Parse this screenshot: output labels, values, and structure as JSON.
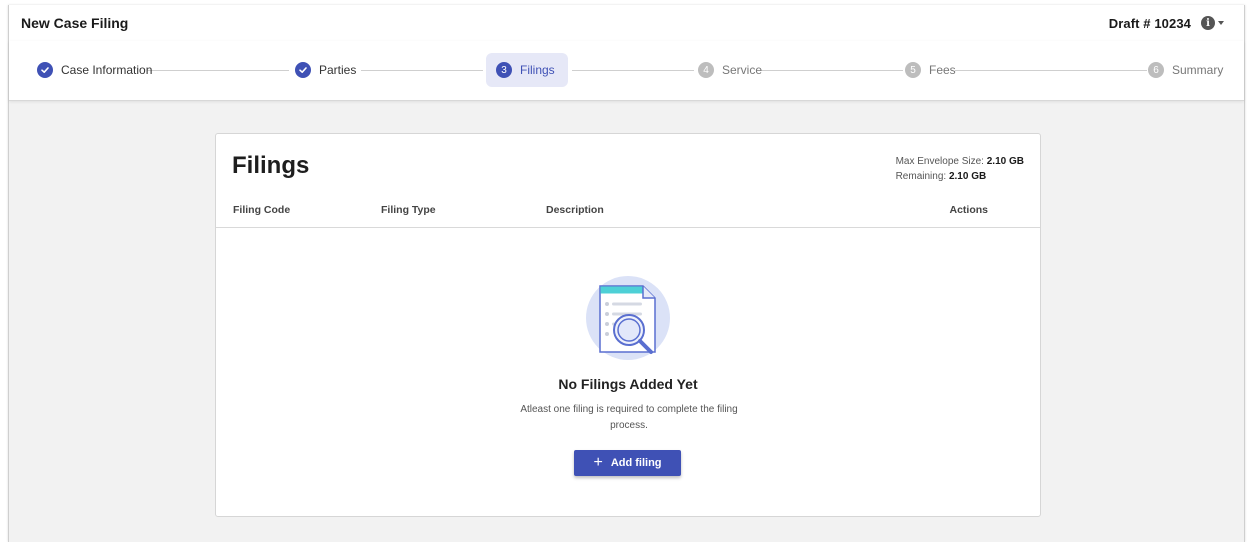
{
  "header": {
    "title": "New Case Filing",
    "draft": "Draft # 10234",
    "info_icon": "info-icon"
  },
  "stepper": {
    "steps": [
      {
        "label": "Case Information",
        "status": "done"
      },
      {
        "label": "Parties",
        "status": "done"
      },
      {
        "number": "3",
        "label": "Filings",
        "status": "active"
      },
      {
        "number": "4",
        "label": "Service",
        "status": "pending"
      },
      {
        "number": "5",
        "label": "Fees",
        "status": "pending"
      },
      {
        "number": "6",
        "label": "Summary",
        "status": "pending"
      }
    ]
  },
  "filings": {
    "title": "Filings",
    "max_envelope_label": "Max Envelope Size:",
    "max_envelope_value": "2.10 GB",
    "remaining_label": "Remaining:",
    "remaining_value": "2.10 GB",
    "columns": [
      "Filing Code",
      "Filing Type",
      "Description",
      "Actions"
    ],
    "empty_title": "No Filings Added Yet",
    "empty_desc": "Atleast one filing is required to complete the filing process.",
    "add_button": "Add filing"
  },
  "colors": {
    "accent": "#3f51b5",
    "active_step_bg": "#e6e8f7",
    "background": "#f2f2f2"
  }
}
